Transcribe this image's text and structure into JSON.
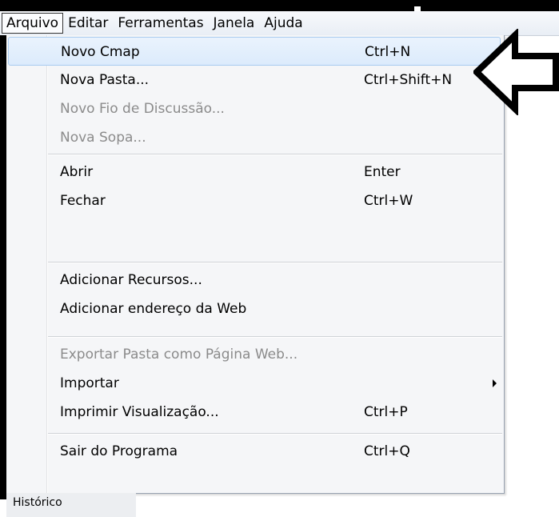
{
  "menubar": {
    "items": [
      "Arquivo",
      "Editar",
      "Ferramentas",
      "Janela",
      "Ajuda"
    ],
    "active": "Arquivo"
  },
  "menu": {
    "items": [
      {
        "label": "Novo Cmap",
        "accel": "Ctrl+N",
        "enabled": true,
        "highlighted": true
      },
      {
        "label": "Nova Pasta...",
        "accel": "Ctrl+Shift+N",
        "enabled": true
      },
      {
        "label": "Novo Fio de Discussão...",
        "accel": "",
        "enabled": false
      },
      {
        "label": "Nova Sopa...",
        "accel": "",
        "enabled": false
      },
      {
        "label": "Abrir",
        "accel": "Enter",
        "enabled": true
      },
      {
        "label": "Fechar",
        "accel": "Ctrl+W",
        "enabled": true
      },
      {
        "label": "Adicionar Recursos...",
        "accel": "",
        "enabled": true
      },
      {
        "label": "Adicionar endereço da Web",
        "accel": "",
        "enabled": true
      },
      {
        "label": "Exportar Pasta como Página Web...",
        "accel": "",
        "enabled": false
      },
      {
        "label": "Importar",
        "accel": "",
        "enabled": true,
        "submenu": true
      },
      {
        "label": "Imprimir Visualização...",
        "accel": "Ctrl+P",
        "enabled": true
      },
      {
        "label": "Sair do Programa",
        "accel": "Ctrl+Q",
        "enabled": true
      }
    ]
  },
  "bottom_tab": {
    "label": "Histórico"
  },
  "annotation": {
    "icon": "left-arrow-icon",
    "color": "#000000"
  },
  "colors": {
    "highlight_border": "#a8cbf0",
    "disabled_text": "#8b8b8b"
  }
}
